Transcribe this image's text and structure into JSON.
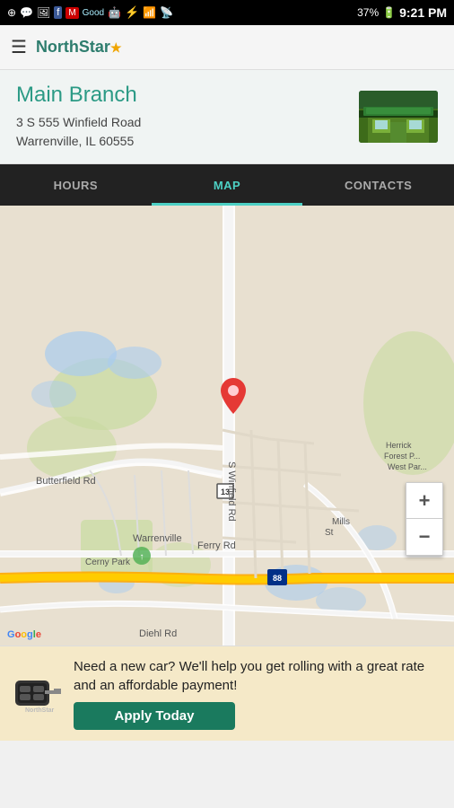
{
  "statusBar": {
    "time": "9:21 PM",
    "battery": "37%",
    "icons": [
      "add",
      "messenger",
      "image",
      "facebook",
      "mail",
      "good",
      "android",
      "bluetooth",
      "wifi",
      "signal",
      "battery"
    ]
  },
  "navBar": {
    "menuLabel": "☰",
    "logoText": "NorthStar",
    "logoStar": "★"
  },
  "branchInfo": {
    "name": "Main Branch",
    "addressLine1": "3 S 555 Winfield Road",
    "addressLine2": "Warrenville, IL  60555"
  },
  "tabs": [
    {
      "id": "hours",
      "label": "HOURS",
      "active": false
    },
    {
      "id": "map",
      "label": "MAP",
      "active": true
    },
    {
      "id": "contacts",
      "label": "CONTACTS",
      "active": false
    }
  ],
  "map": {
    "zoomIn": "+",
    "zoomOut": "−",
    "googleText": "Google",
    "labels": {
      "street1": "S Winfield Rd",
      "street2": "Butterfield Rd",
      "street3": "Ferry Rd",
      "street4": "Mills St",
      "street5": "Diehl Rd",
      "city": "Warrenville",
      "park1": "Cerny Park",
      "park2": "Herrick Forest P... West Par...",
      "highway13": "13",
      "highway88": "88"
    }
  },
  "adBanner": {
    "text": "Need a new car?  We'll help you get rolling with a great rate and an affordable payment!",
    "buttonLabel": "Apply Today"
  }
}
